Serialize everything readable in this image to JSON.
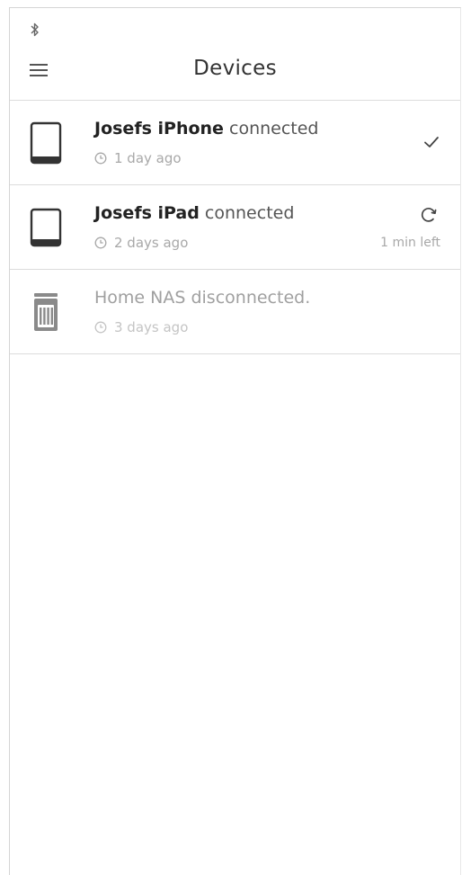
{
  "header": {
    "title": "Devices",
    "menu_icon": "hamburger-menu-icon",
    "status_icon": "bluetooth-icon"
  },
  "devices": [
    {
      "name": "Josefs iPhone",
      "status": "connected",
      "last_seen": "1 day ago",
      "icon": "phone-icon",
      "state_icon": "checkmark-icon"
    },
    {
      "name": "Josefs iPad",
      "status": "connected",
      "last_seen": "2 days ago",
      "icon": "tablet-icon",
      "state_icon": "sync-icon",
      "time_left": "1 min left"
    },
    {
      "name": "Home NAS",
      "status": "disconnected.",
      "last_seen": "3 days ago",
      "icon": "nas-server-icon"
    }
  ],
  "colors": {
    "text_primary": "#222222",
    "text_muted": "#a8a8a8",
    "divider": "#dcdcdc"
  }
}
